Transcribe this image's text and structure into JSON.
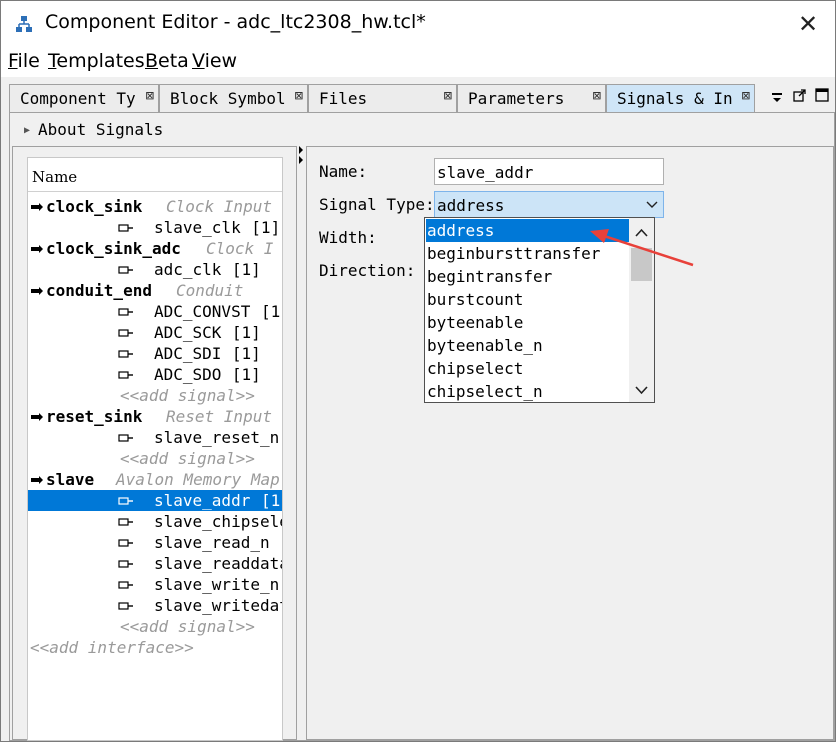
{
  "window": {
    "title": "Component Editor - adc_ltc2308_hw.tcl*",
    "close_glyph": "✕"
  },
  "menu": [
    {
      "mnemonic": "F",
      "rest": "ile"
    },
    {
      "mnemonic": "T",
      "rest": "emplates"
    },
    {
      "mnemonic": "B",
      "rest": "eta"
    },
    {
      "mnemonic": "V",
      "rest": "iew"
    }
  ],
  "tabs": [
    {
      "label": "Component Ty"
    },
    {
      "label": "Block Symbol"
    },
    {
      "label": "Files"
    },
    {
      "label": "Parameters"
    },
    {
      "label": "Signals & In"
    }
  ],
  "tab_close_glyph": "⊠",
  "about": {
    "label": "About Signals"
  },
  "tree": {
    "header": "Name",
    "interfaces": [
      {
        "name": "clock_sink",
        "type": "Clock Input",
        "signals": [
          {
            "name": "slave_clk",
            "width": "[1]"
          }
        ],
        "add_signal": ""
      },
      {
        "name": "clock_sink_adc",
        "type": "Clock I",
        "signals": [
          {
            "name": "adc_clk",
            "width": "[1]"
          }
        ],
        "add_signal": ""
      },
      {
        "name": "conduit_end",
        "type": "Conduit",
        "signals": [
          {
            "name": "ADC_CONVST",
            "width": "[1"
          },
          {
            "name": "ADC_SCK",
            "width": "[1]"
          },
          {
            "name": "ADC_SDI",
            "width": "[1]"
          },
          {
            "name": "ADC_SDO",
            "width": "[1]"
          }
        ],
        "add_signal": "<<add signal>>"
      },
      {
        "name": "reset_sink",
        "type": "Reset Input",
        "signals": [
          {
            "name": "slave_reset_n",
            "width": ""
          }
        ],
        "add_signal": "<<add signal>>"
      },
      {
        "name": "slave",
        "type": "Avalon Memory Map",
        "signals": [
          {
            "name": "slave_addr",
            "width": "[1"
          },
          {
            "name": "slave_chipselec",
            "width": ""
          },
          {
            "name": "slave_read_n",
            "width": ""
          },
          {
            "name": "slave_readdata",
            "width": ""
          },
          {
            "name": "slave_write_n",
            "width": ""
          },
          {
            "name": "slave_writedata",
            "width": ""
          }
        ],
        "add_signal": "<<add signal>>"
      }
    ],
    "add_interface": "<<add interface>>"
  },
  "form": {
    "name_label": "Name:",
    "name_value": "slave_addr",
    "signal_type_label": "Signal Type:",
    "signal_type_value": "address",
    "width_label": "Width:",
    "direction_label": "Direction:"
  },
  "dropdown": {
    "options": [
      "address",
      "beginbursttransfer",
      "begintransfer",
      "burstcount",
      "byteenable",
      "byteenable_n",
      "chipselect",
      "chipselect_n"
    ],
    "selected_index": 0
  },
  "colors": {
    "selection": "#0078d7",
    "annotation_arrow": "#e8413a",
    "active_tab": "#cfe5f7"
  }
}
